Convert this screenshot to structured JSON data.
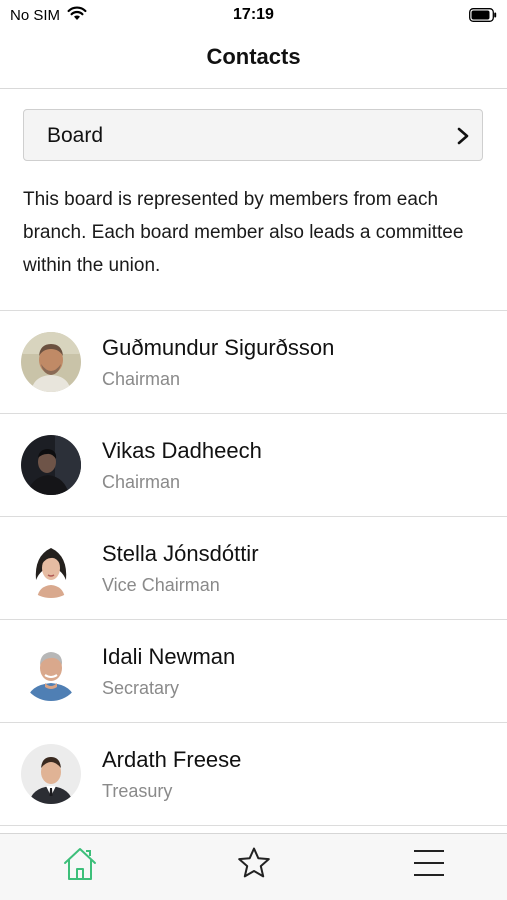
{
  "status_bar": {
    "carrier": "No SIM",
    "time": "17:19"
  },
  "nav": {
    "title": "Contacts"
  },
  "selector": {
    "label": "Board"
  },
  "description": "This board is represented by members from each branch. Each board member also leads a committee within the union.",
  "contacts": [
    {
      "name": "Guðmundur Sigurðsson",
      "role": "Chairman"
    },
    {
      "name": "Vikas Dadheech",
      "role": "Chairman"
    },
    {
      "name": "Stella Jónsdóttir",
      "role": "Vice Chairman"
    },
    {
      "name": "Idali Newman",
      "role": "Secratary"
    },
    {
      "name": "Ardath Freese",
      "role": "Treasury"
    }
  ],
  "tab_bar": {
    "items": [
      {
        "icon": "home-icon",
        "active": true
      },
      {
        "icon": "star-icon",
        "active": false
      },
      {
        "icon": "menu-icon",
        "active": false
      }
    ]
  },
  "colors": {
    "accent": "#3dbf7a",
    "secondary_text": "#8a8a8a",
    "divider": "#dcdcdc"
  }
}
